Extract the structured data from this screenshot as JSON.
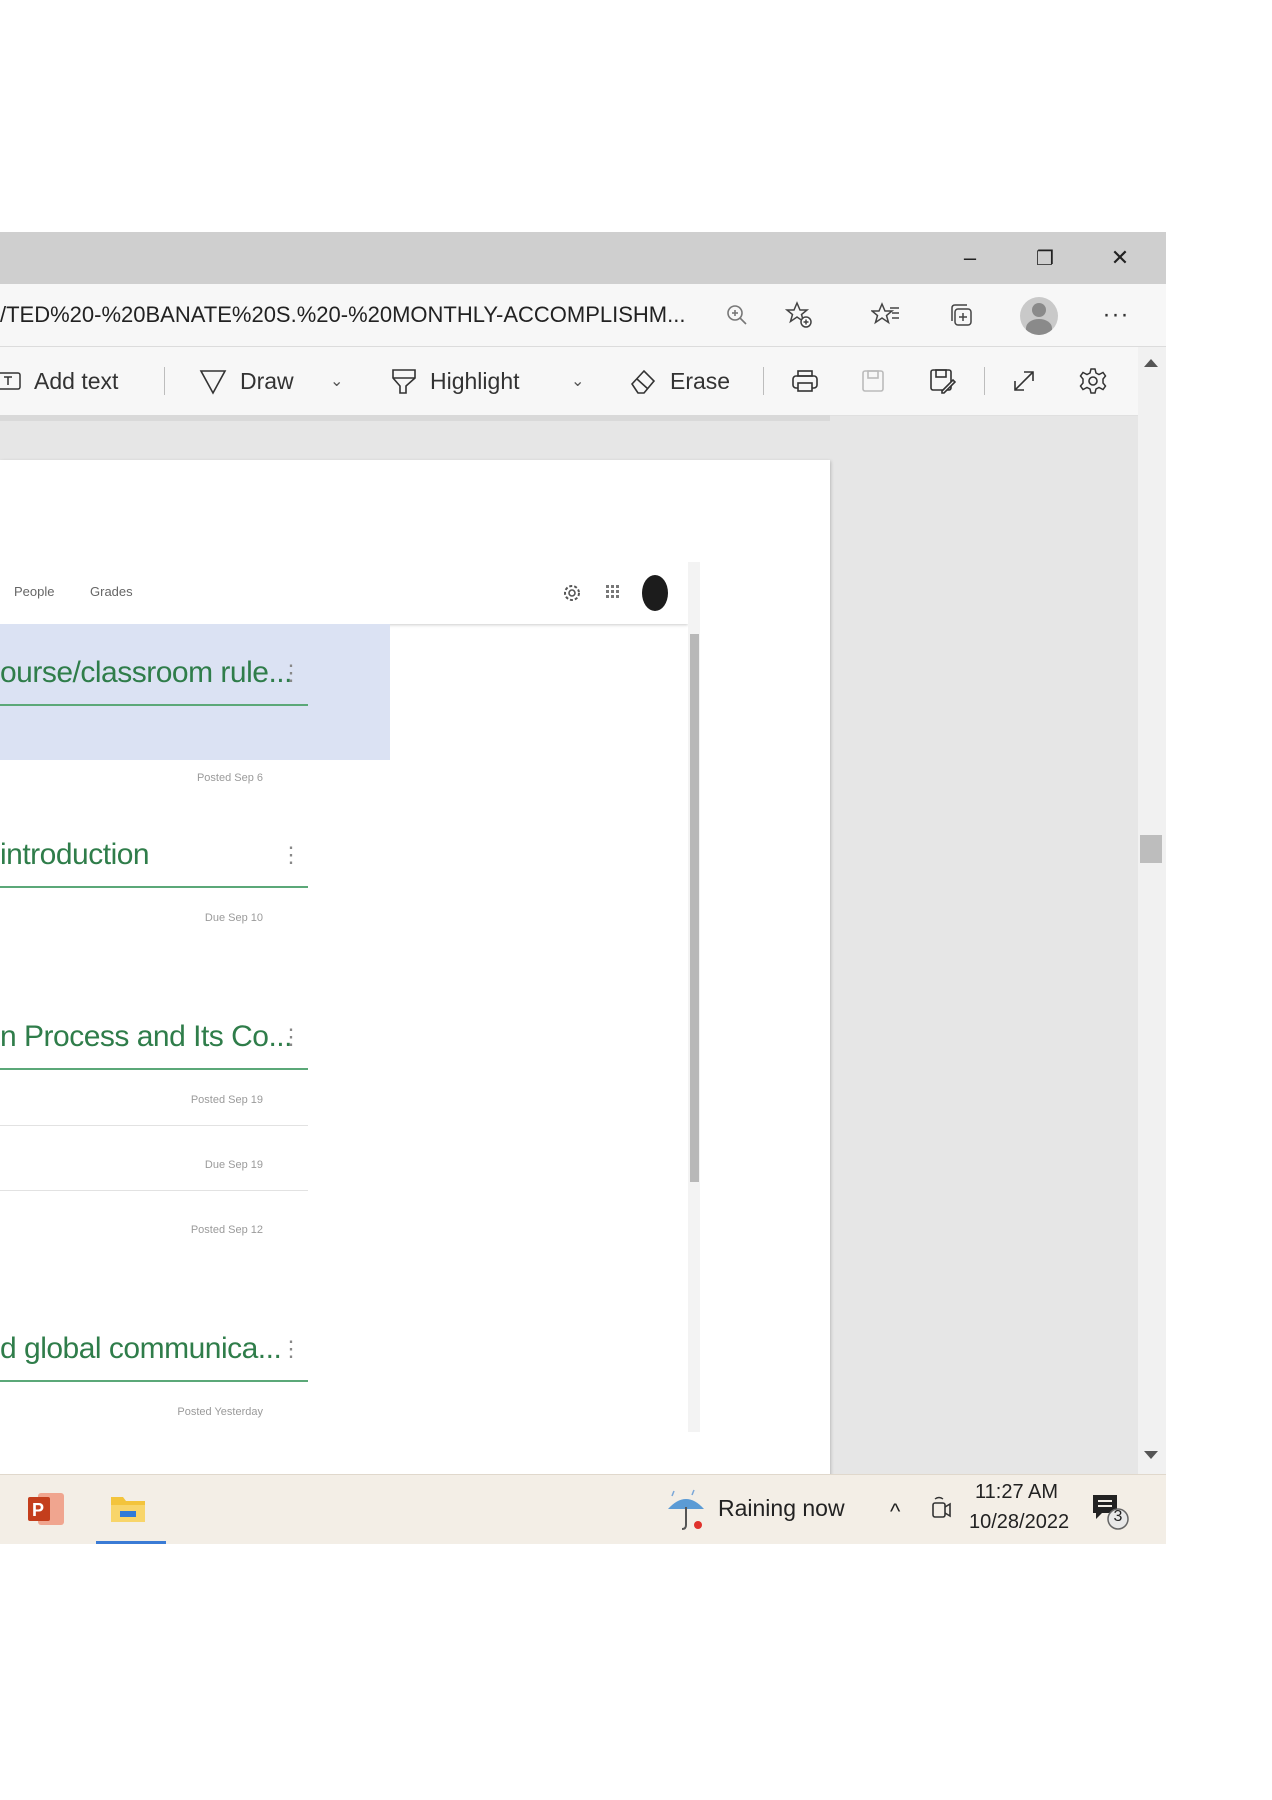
{
  "window": {
    "minimize": "–",
    "restore": "❐",
    "close": "✕"
  },
  "address": {
    "url": "/TED%20-%20BANATE%20S.%20-%20MONTHLY-ACCOMPLISHM..."
  },
  "pdf_toolbar": {
    "add_text": "Add text",
    "draw": "Draw",
    "highlight": "Highlight",
    "erase": "Erase"
  },
  "classroom": {
    "nav": [
      "People",
      "Grades"
    ],
    "cards": [
      {
        "title": "ourse/classroom rule...",
        "rows": [
          "Posted Sep 6"
        ]
      },
      {
        "title": "introduction",
        "rows": [
          "Due Sep 10"
        ]
      },
      {
        "title": "n Process and Its Co...",
        "rows": [
          "Posted Sep 19",
          "Due Sep 19",
          "Posted Sep 12"
        ]
      },
      {
        "title": "d global communica...",
        "rows": [
          "Posted Yesterday"
        ]
      }
    ]
  },
  "taskbar": {
    "weather": "Raining now",
    "time": "11:27 AM",
    "date": "10/28/2022",
    "notification_count": "3"
  }
}
